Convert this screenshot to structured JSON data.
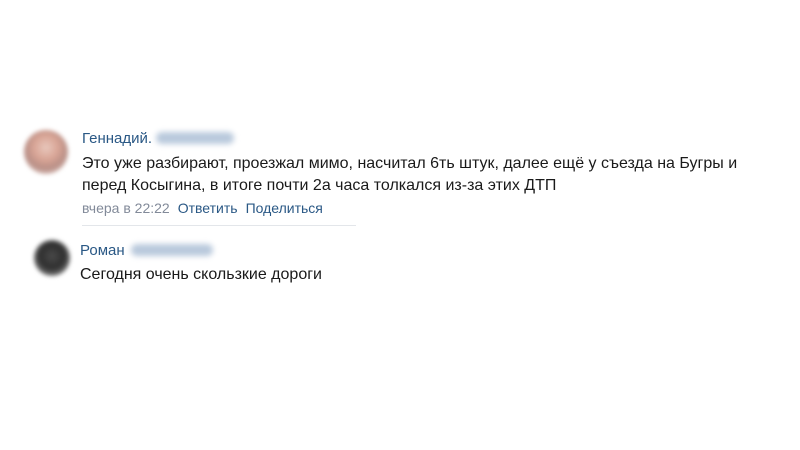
{
  "comments": [
    {
      "author": "Геннадий",
      "author_initial": ".",
      "text_line_1": "Это уже разбирают, проезжал мимо, насчитал 6ть штук, далее ещё у съезда на Бугры и",
      "text_line_2": "перед Косыгина, в итоге почти 2а часа толкался из-за этих ДТП",
      "time": "вчера в 22:22",
      "reply_label": "Ответить",
      "share_label": "Поделиться",
      "avatar_icon": "user-photo-blurred"
    },
    {
      "author": "Роман",
      "text_line_1": "Сегодня очень скользкие дороги",
      "avatar_icon": "user-photo-blurred"
    }
  ],
  "colors": {
    "link": "#2a5885",
    "muted": "#828a99",
    "divider": "#e3e6ea",
    "text": "#1a1a1a"
  }
}
